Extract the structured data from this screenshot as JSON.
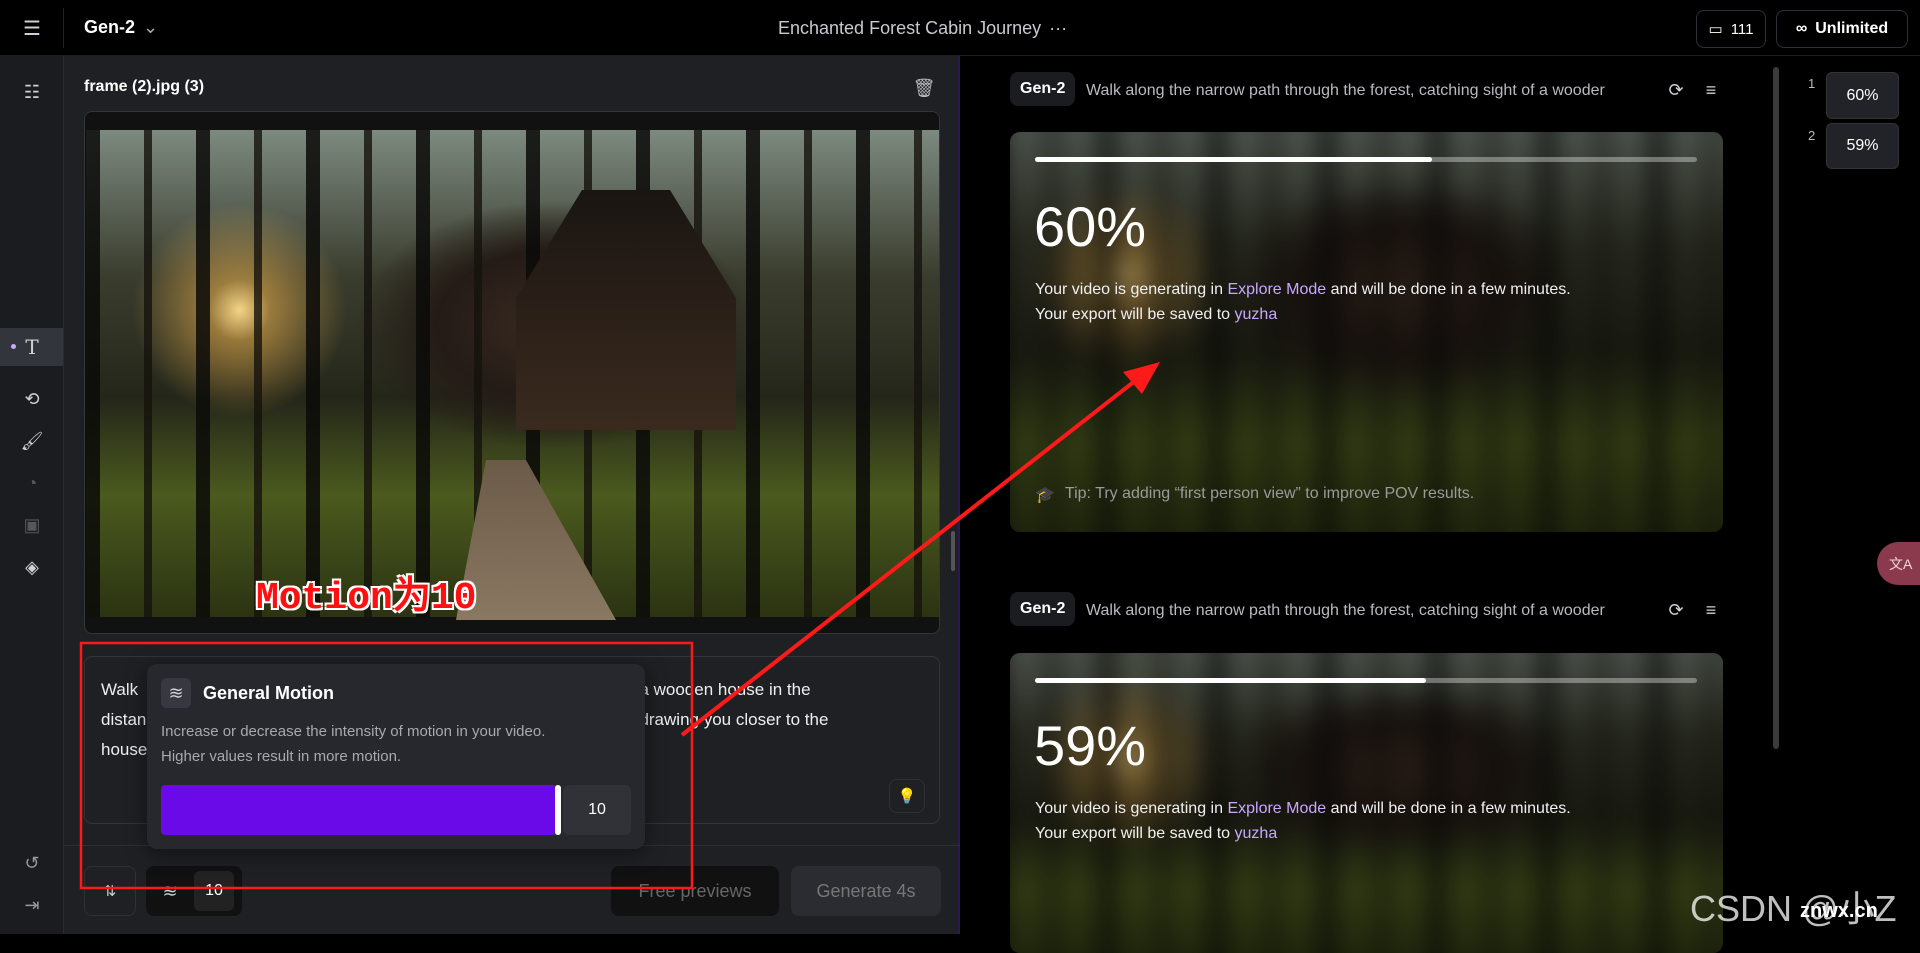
{
  "topbar": {
    "model": "Gen-2",
    "project_title": "Enchanted Forest Cabin Journey",
    "more": "···",
    "assets_count": "111",
    "plan": "Unlimited"
  },
  "left_panel": {
    "file_name": "frame (2).jpg (3)",
    "prompt_fragments": [
      [
        "Walk",
        "f a wooden house in the"
      ],
      [
        "distan",
        ", drawing you closer to the"
      ],
      [
        "house",
        ""
      ]
    ],
    "bottom": {
      "motion_value": "10",
      "free_previews": "Free previews",
      "generate": "Generate 4s"
    }
  },
  "motion_popup": {
    "title": "General Motion",
    "description_line1": "Increase or decrease the intensity of motion in your video.",
    "description_line2": "Higher values result in more motion.",
    "value": "10",
    "fraction": 1.0,
    "accent": "#6a0ae8"
  },
  "annotation": {
    "label": "Motion为10",
    "color": "#ff1a1a"
  },
  "generations": [
    {
      "model": "Gen-2",
      "prompt": "Walk along the narrow path through the forest, catching sight of a wooder",
      "progress": 60,
      "percent": "60%",
      "msg_a": "Your video is generating in ",
      "mode": "Explore Mode",
      "msg_b": " and will be done in a few minutes.",
      "save_a": "Your export will be saved to ",
      "folder": "yuzha",
      "tip": "Tip: Try adding “first person view” to improve POV results."
    },
    {
      "model": "Gen-2",
      "prompt": "Walk along the narrow path through the forest, catching sight of a wooder",
      "progress": 59,
      "percent": "59%",
      "msg_a": "Your video is generating in ",
      "mode": "Explore Mode",
      "msg_b": " and will be done in a few minutes.",
      "save_a": "Your export will be saved to ",
      "folder": "yuzha"
    }
  ],
  "queue": [
    {
      "index": "1",
      "percent": "60%"
    },
    {
      "index": "2",
      "percent": "59%"
    }
  ],
  "translate_icon": "文A",
  "watermark": "CSDN @小Z",
  "watermark2": "znwx.cn"
}
